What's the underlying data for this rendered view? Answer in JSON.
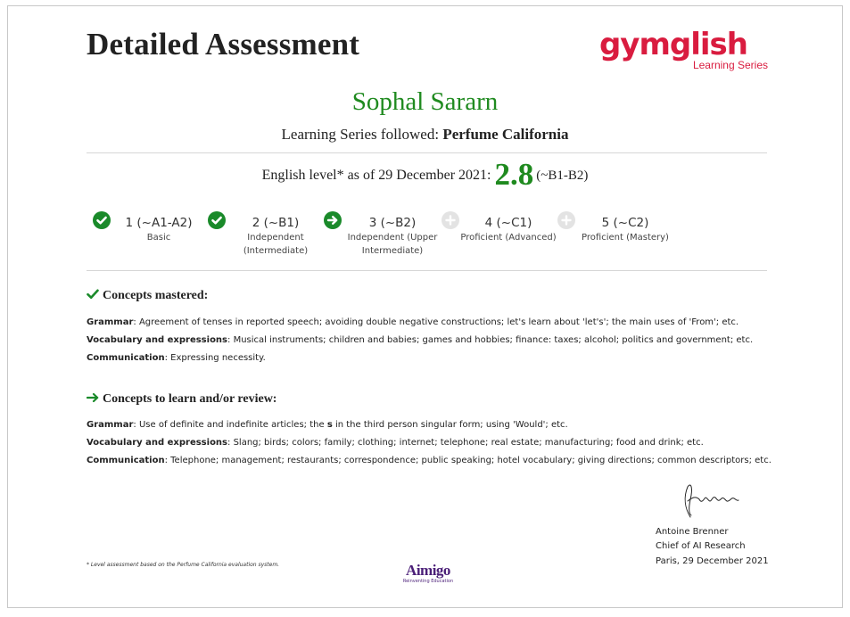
{
  "document": {
    "title": "Detailed Assessment",
    "learner_name": "Sophal Sararn",
    "series_label": "Learning Series followed:",
    "series_name": "Perfume California"
  },
  "brand": {
    "logo_text": "gymglish",
    "logo_sub": "Learning Series",
    "color": "#d91c3f"
  },
  "level": {
    "prefix": "English level* as of 29 December 2021:",
    "score": "2.8",
    "cefr": "(~B1-B2)",
    "accent": "#1f8a1f",
    "steps": [
      {
        "title": "1 (~A1-A2)",
        "sub1": "Basic",
        "sub2": "",
        "status": "done",
        "icon": "check-circle-icon"
      },
      {
        "title": "2 (~B1)",
        "sub1": "Independent",
        "sub2": "(Intermediate)",
        "status": "done",
        "icon": "check-circle-icon"
      },
      {
        "title": "3 (~B2)",
        "sub1": "Independent (Upper",
        "sub2": "Intermediate)",
        "status": "current",
        "icon": "arrow-right-circle-icon"
      },
      {
        "title": "4 (~C1)",
        "sub1": "Proficient (Advanced)",
        "sub2": "",
        "status": "todo",
        "icon": "plus-circle-icon"
      },
      {
        "title": "5 (~C2)",
        "sub1": "Proficient (Mastery)",
        "sub2": "",
        "status": "todo",
        "icon": "plus-circle-icon"
      }
    ]
  },
  "mastered": {
    "heading": "Concepts mastered:",
    "icon": "check-icon",
    "items": [
      {
        "key": "Grammar",
        "text": ": Agreement of tenses in reported speech; avoiding double negative constructions; let's learn about 'let's'; the main uses of 'From'; etc."
      },
      {
        "key": "Vocabulary and expressions",
        "text": ": Musical instruments; children and babies; games and hobbies; finance: taxes; alcohol; politics and government; etc."
      },
      {
        "key": "Communication",
        "text": ": Expressing necessity."
      }
    ]
  },
  "review": {
    "heading": "Concepts to learn and/or review:",
    "icon": "arrow-right-icon",
    "grammar_key": "Grammar",
    "grammar_a": ": Use of definite and indefinite articles; the ",
    "grammar_bold": "s",
    "grammar_b": " in the third person singular form; using 'Would'; etc.",
    "items": [
      {
        "key": "Vocabulary and expressions",
        "text": ": Slang; birds; colors; family; clothing; internet; telephone; real estate; manufacturing; food and drink; etc."
      },
      {
        "key": "Communication",
        "text": ": Telephone; management; restaurants; correspondence; public speaking; hotel vocabulary; giving directions; common descriptors; etc."
      }
    ]
  },
  "signature": {
    "name": "Antoine Brenner",
    "role": "Chief of AI Research",
    "place_date": "Paris, 29 December 2021"
  },
  "footer": {
    "note": "* Level assessment based on the Perfume California evaluation system.",
    "partner_logo": "Aimigo",
    "partner_tagline": "Reinventing Education"
  }
}
